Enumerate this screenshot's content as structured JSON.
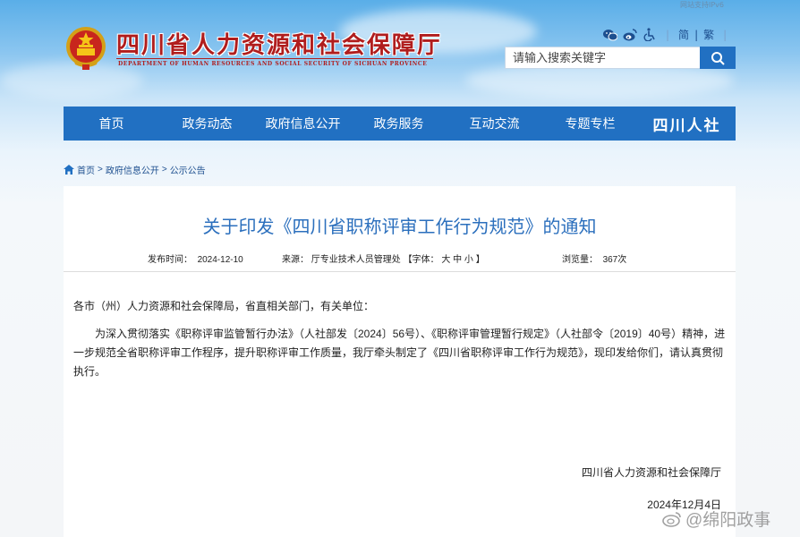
{
  "header": {
    "site_title": "四川省人力资源和社会保障厅",
    "site_subtitle": "DEPARTMENT OF HUMAN RESOURCES AND SOCIAL SECURITY OF SICHUAN PROVINCE",
    "top_link": "网站支持IPv6",
    "lang_simplified": "简",
    "lang_divider": "|",
    "lang_traditional": "繁",
    "search_placeholder": "请输入搜索关键字",
    "tool_icons": [
      "wechat-icon",
      "weibo-icon",
      "accessibility-icon"
    ]
  },
  "nav": {
    "items": [
      "首页",
      "政务动态",
      "政府信息公开",
      "政务服务",
      "互动交流",
      "专题专栏"
    ],
    "logo_text": "四川人社"
  },
  "breadcrumb": [
    "首页",
    "政府信息公开",
    "公示公告"
  ],
  "breadcrumb_sep": ">",
  "article": {
    "title": "关于印发《四川省职称评审工作行为规范》的通知",
    "publish_label": "发布时间：",
    "publish_date": "2024-12-10",
    "source_label": "来源：",
    "source": "厅专业技术人员管理处",
    "font_label": "【字体：",
    "font_large": "大",
    "font_medium": "中",
    "font_small": "小",
    "font_end": "】",
    "views_label": "浏览量：",
    "views": "367次",
    "salutation": "各市（州）人力资源和社会保障局，省直相关部门，有关单位：",
    "paragraph": "为深入贯彻落实《职称评审监管暂行办法》（人社部发〔2024〕56号）、《职称评审管理暂行规定》（人社部令〔2019〕40号）精神，进一步规范全省职称评审工作程序，提升职称评审工作质量，我厅牵头制定了《四川省职称评审工作行为规范》，现印发给你们，请认真贯彻执行。",
    "signature": "四川省人力资源和社会保障厅",
    "sign_date": "2024年12月4日"
  },
  "watermark": "@绵阳政事",
  "colors": {
    "nav_blue": "#2170c2",
    "title_blue": "#2b6fbd",
    "brand_red": "#b01d1d"
  }
}
